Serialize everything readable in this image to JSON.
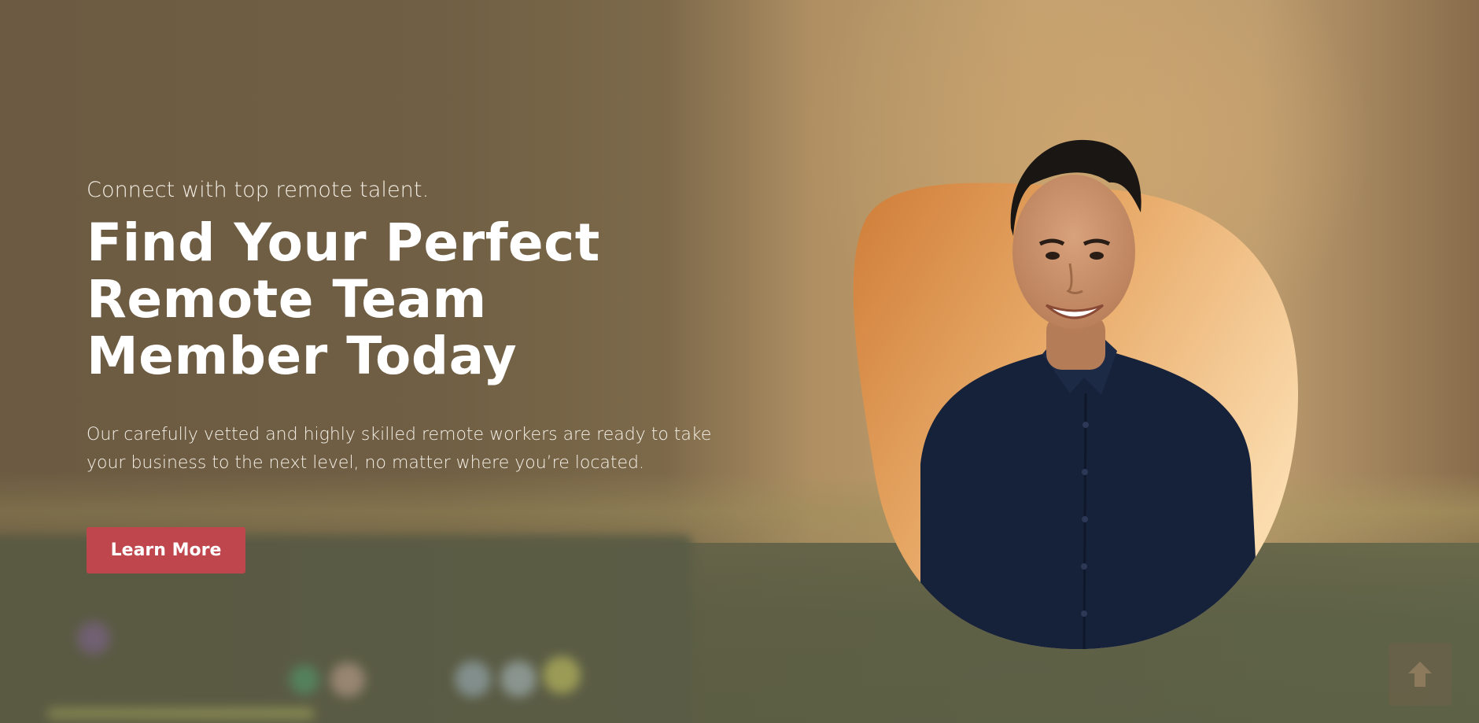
{
  "hero": {
    "tagline": "Connect with top remote talent.",
    "headline_lines": [
      "Find Your Perfect",
      "Remote Team",
      "Member Today"
    ],
    "description": "Our carefully vetted and highly skilled remote workers are ready to take your business to the next level, no matter where you’re located.",
    "cta_label": "Learn More",
    "portrait_icon": "person-portrait-image"
  },
  "scroll_top": {
    "icon": "arrow-up-icon"
  },
  "colors": {
    "cta_background": "#c0464d",
    "headline_text": "#ffffff",
    "blob_gradient_start": "#cf7d38",
    "blob_gradient_end": "#fbdcae",
    "shirt": "#16213a"
  }
}
